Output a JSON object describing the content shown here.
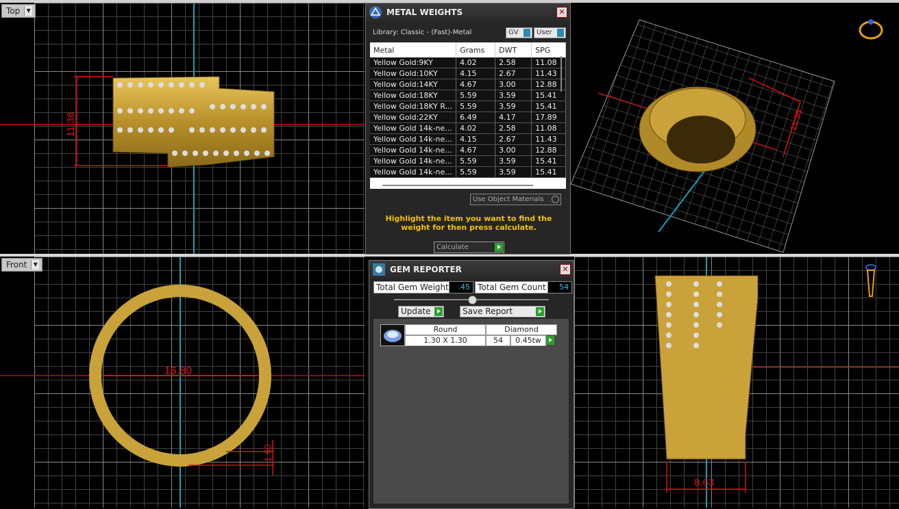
{
  "viewports": {
    "top": {
      "label": "Top",
      "dimension": "11.36"
    },
    "front": {
      "label": "Front",
      "diameter": "16.80",
      "thickness": "1.60"
    },
    "side": {
      "width": "8.63"
    },
    "perspective": {
      "dimension": "11.36"
    }
  },
  "metal_weights": {
    "title": "METAL WEIGHTS",
    "library": "Library: Classic - (Fast)-Metal",
    "gv_label": "GV",
    "user_label": "User",
    "columns": [
      "Metal",
      "Grams",
      "DWT",
      "SPG"
    ],
    "rows": [
      {
        "metal": "Yellow Gold:9KY",
        "grams": "4.02",
        "dwt": "2.58",
        "spg": "11.08"
      },
      {
        "metal": "Yellow Gold:10KY",
        "grams": "4.15",
        "dwt": "2.67",
        "spg": "11.43"
      },
      {
        "metal": "Yellow Gold:14KY",
        "grams": "4.67",
        "dwt": "3.00",
        "spg": "12.88"
      },
      {
        "metal": "Yellow Gold:18KY",
        "grams": "5.59",
        "dwt": "3.59",
        "spg": "15.41"
      },
      {
        "metal": "Yellow Gold:18KY R...",
        "grams": "5.59",
        "dwt": "3.59",
        "spg": "15.41"
      },
      {
        "metal": "Yellow Gold:22KY",
        "grams": "6.49",
        "dwt": "4.17",
        "spg": "17.89"
      },
      {
        "metal": "Yellow Gold 14k-ne...",
        "grams": "4.02",
        "dwt": "2.58",
        "spg": "11.08"
      },
      {
        "metal": "Yellow Gold 14k-ne...",
        "grams": "4.15",
        "dwt": "2.67",
        "spg": "11.43"
      },
      {
        "metal": "Yellow Gold 14k-ne...",
        "grams": "4.67",
        "dwt": "3.00",
        "spg": "12.88"
      },
      {
        "metal": "Yellow Gold 14k-ne...",
        "grams": "5.59",
        "dwt": "3.59",
        "spg": "15.41"
      },
      {
        "metal": "Yellow Gold 14k-ne...",
        "grams": "5.59",
        "dwt": "3.59",
        "spg": "15.41"
      }
    ],
    "use_object_materials": "Use Object Materials",
    "hint": "Highlight the item you want to find the weight for then press calculate.",
    "calculate_label": "Calculate"
  },
  "gem_reporter": {
    "title": "GEM REPORTER",
    "total_weight_label": "Total Gem Weight",
    "total_weight_value": ".45",
    "total_count_label": "Total Gem Count",
    "total_count_value": "54",
    "update_label": "Update",
    "save_report_label": "Save Report",
    "gem": {
      "shape": "Round",
      "type": "Diamond",
      "size": "1.30 X 1.30",
      "count": "54",
      "weight": "0.45tw"
    }
  },
  "colors": {
    "gold": "#c9a23a",
    "dimension": "#e01010",
    "axis": "#1aa0b8",
    "hint": "#f2c200",
    "go": "#2fa02f"
  }
}
